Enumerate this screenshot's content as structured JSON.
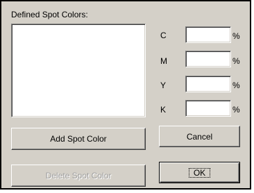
{
  "dialog": {
    "list_label": "Defined Spot Colors:",
    "list_items": []
  },
  "cmyk": {
    "fields": [
      {
        "label": "C",
        "value": "",
        "unit": "%"
      },
      {
        "label": "M",
        "value": "",
        "unit": "%"
      },
      {
        "label": "Y",
        "value": "",
        "unit": "%"
      },
      {
        "label": "K",
        "value": "",
        "unit": "%"
      }
    ]
  },
  "buttons": {
    "add": "Add Spot Color",
    "delete": "Delete Spot Color",
    "cancel": "Cancel",
    "ok": "OK"
  },
  "colors": {
    "dialog_face": "#d4d0c8",
    "disabled_text": "#a0a0a0"
  }
}
